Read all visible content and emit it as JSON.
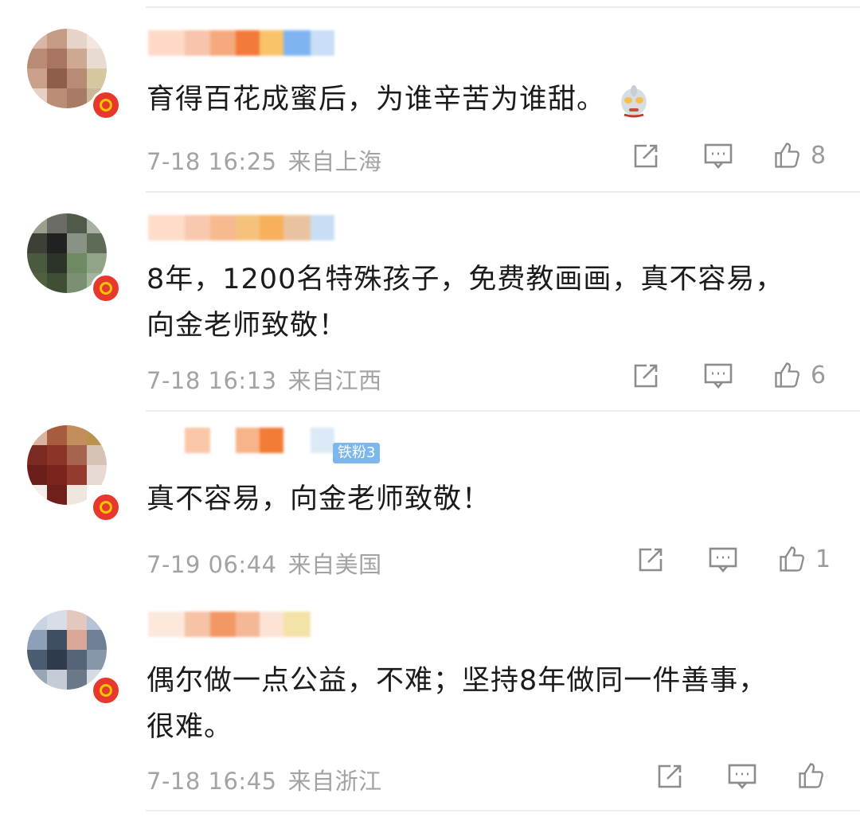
{
  "comments": [
    {
      "text": "育得百花成蜜后，为谁辛苦为谁甜。",
      "time": "7-18 16:25",
      "location": "来自上海",
      "likes": "8",
      "avatar_colors": [
        "#d9b6a5",
        "#c59b86",
        "#e7d3c8",
        "#f3e6df",
        "#b98a74",
        "#a87562",
        "#cfa893",
        "#e8dcd2",
        "#c9a08b",
        "#8e5e4a",
        "#b88b77",
        "#d5c7a0",
        "#e6cfc3",
        "#bb8c76",
        "#a97b66",
        "#cbb79a"
      ],
      "name_colors": [
        "#ffd9c8",
        "#f7c4ad",
        "#f5a97d",
        "#f27a3a",
        "#f9c36a",
        "#7fb4f0",
        "#c9def7"
      ]
    },
    {
      "text": "8年，1200名特殊孩子，免费教画画，真不容易，向金老师致敬！",
      "time": "7-18 16:13",
      "location": "来自江西",
      "likes": "6",
      "avatar_colors": [
        "#9aa08e",
        "#6c6c66",
        "#4f5a4a",
        "#a7b0a3",
        "#3d4037",
        "#1f2220",
        "#8a9185",
        "#5d6b57",
        "#4a5a3f",
        "#2c3329",
        "#6f8a63",
        "#92a487",
        "#50603f",
        "#3f4f36",
        "#7a9070",
        "#a5b59d"
      ],
      "name_colors": [
        "#ffdcc9",
        "#f9c8b0",
        "#f7b98f",
        "#f4c27a",
        "#f7b05c",
        "#e9c3a0",
        "#c8def5"
      ]
    },
    {
      "text": "真不容易，向金老师致敬！",
      "time": "7-19 06:44",
      "location": "来自美国",
      "likes": "1",
      "fan_badge": "铁粉3",
      "avatar_colors": [
        "#d8b4a0",
        "#a85c3e",
        "#c38d5c",
        "#b9924c",
        "#7b2a22",
        "#8c342a",
        "#a4644d",
        "#d6c2b7",
        "#6b1f1a",
        "#7a241d",
        "#943a2f",
        "#e6d9d2",
        "#f4eeea",
        "#6f201a",
        "#f0e6e0",
        "#ffffff"
      ],
      "name_colors": [
        "#ffffff",
        "#f9c7a8",
        "#ffffff",
        "#f7b48a",
        "#f27b36",
        "#ffffff",
        "#dce9f7"
      ]
    },
    {
      "text": "偶尔做一点公益，不难；坚持8年做同一件善事，很难。",
      "time": "7-18 16:45",
      "location": "来自浙江",
      "likes": "",
      "avatar_colors": [
        "#c9d4e3",
        "#d8dde8",
        "#e3c9bd",
        "#b6c3d5",
        "#8ea0b8",
        "#3f4e63",
        "#d8a795",
        "#6f7f96",
        "#4b5b70",
        "#2d3b4d",
        "#556577",
        "#8796a8",
        "#9aa6b5",
        "#c5ccd6",
        "#6a788a",
        "#d5dbe3"
      ],
      "name_colors": [
        "#fde8dd",
        "#f6c3a7",
        "#f39865",
        "#f5b896",
        "#fde3d6",
        "#f3e3a6"
      ]
    }
  ],
  "icons": {
    "share": "share-icon",
    "reply": "comment-icon",
    "like": "thumbs-up-icon",
    "verified": "verified-badge-icon",
    "emoji": "ultraman-emoji-icon"
  },
  "colors": {
    "text": "#1b1b1b",
    "meta": "#a3a3a3",
    "badge_red": "#e8372c",
    "badge_ring": "#f7c400",
    "separator": "#ededed"
  }
}
